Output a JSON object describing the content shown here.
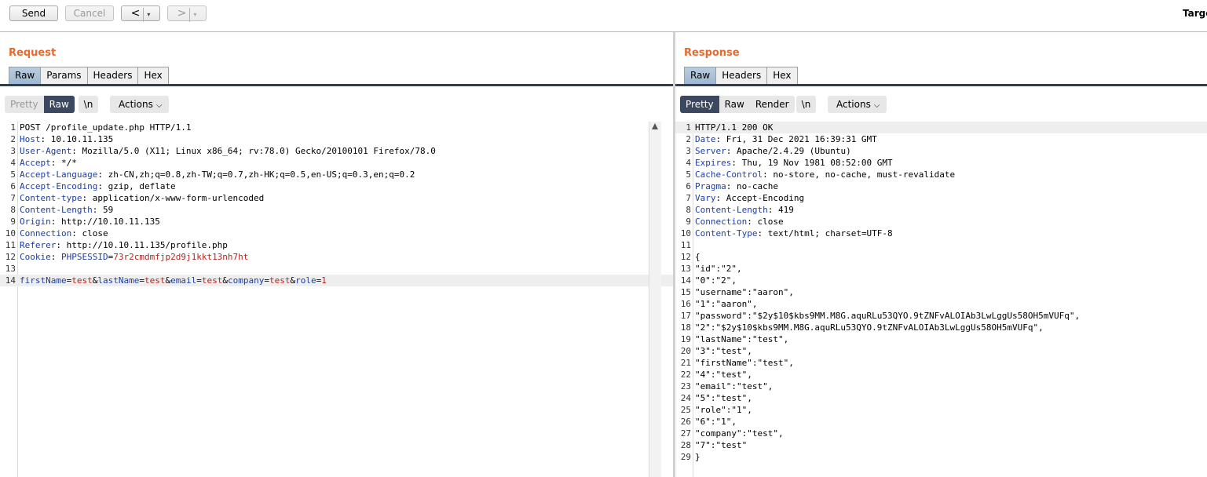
{
  "toolbar": {
    "send_label": "Send",
    "cancel_label": "Cancel",
    "back_arrow": "<",
    "forward_arrow": ">",
    "caret": "▾",
    "target_label": "Targe"
  },
  "request": {
    "title": "Request",
    "tabs": [
      "Raw",
      "Params",
      "Headers",
      "Hex"
    ],
    "active_tab": "Raw",
    "view_modes": [
      "Pretty",
      "Raw"
    ],
    "active_view": "Raw",
    "newline_label": "\\n",
    "actions_label": "Actions",
    "lines": [
      {
        "n": "1",
        "type": "plain",
        "text": "POST /profile_update.php HTTP/1.1"
      },
      {
        "n": "2",
        "type": "header",
        "key": "Host",
        "value": " 10.10.11.135"
      },
      {
        "n": "3",
        "type": "header",
        "key": "User-Agent",
        "value": " Mozilla/5.0 (X11; Linux x86_64; rv:78.0) Gecko/20100101 Firefox/78.0"
      },
      {
        "n": "4",
        "type": "header",
        "key": "Accept",
        "value": " */*"
      },
      {
        "n": "5",
        "type": "header",
        "key": "Accept-Language",
        "value": " zh-CN,zh;q=0.8,zh-TW;q=0.7,zh-HK;q=0.5,en-US;q=0.3,en;q=0.2"
      },
      {
        "n": "6",
        "type": "header",
        "key": "Accept-Encoding",
        "value": " gzip, deflate"
      },
      {
        "n": "7",
        "type": "header",
        "key": "Content-type",
        "value": " application/x-www-form-urlencoded"
      },
      {
        "n": "8",
        "type": "header",
        "key": "Content-Length",
        "value": " 59"
      },
      {
        "n": "9",
        "type": "header",
        "key": "Origin",
        "value": " http://10.10.11.135"
      },
      {
        "n": "10",
        "type": "header",
        "key": "Connection",
        "value": " close"
      },
      {
        "n": "11",
        "type": "header",
        "key": "Referer",
        "value": " http://10.10.11.135/profile.php"
      },
      {
        "n": "12",
        "type": "cookie",
        "key": "Cookie",
        "ckey": "PHPSESSID",
        "cval": "73r2cmdmfjp2d9j1kkt13nh7ht"
      },
      {
        "n": "13",
        "type": "plain",
        "text": ""
      },
      {
        "n": "14",
        "type": "params",
        "params": [
          {
            "k": "firstName",
            "v": "test"
          },
          {
            "k": "lastName",
            "v": "test"
          },
          {
            "k": "email",
            "v": "test"
          },
          {
            "k": "company",
            "v": "test"
          },
          {
            "k": "role",
            "v": "1"
          }
        ]
      }
    ]
  },
  "response": {
    "title": "Response",
    "tabs": [
      "Raw",
      "Headers",
      "Hex"
    ],
    "active_tab": "Raw",
    "view_modes": [
      "Pretty",
      "Raw",
      "Render"
    ],
    "active_view": "Pretty",
    "newline_label": "\\n",
    "actions_label": "Actions",
    "lines": [
      {
        "n": "1",
        "type": "plain",
        "text": "HTTP/1.1 200 OK"
      },
      {
        "n": "2",
        "type": "header",
        "key": "Date",
        "value": " Fri, 31 Dec 2021 16:39:31 GMT"
      },
      {
        "n": "3",
        "type": "header",
        "key": "Server",
        "value": " Apache/2.4.29 (Ubuntu)"
      },
      {
        "n": "4",
        "type": "header",
        "key": "Expires",
        "value": " Thu, 19 Nov 1981 08:52:00 GMT"
      },
      {
        "n": "5",
        "type": "header",
        "key": "Cache-Control",
        "value": " no-store, no-cache, must-revalidate"
      },
      {
        "n": "6",
        "type": "header",
        "key": "Pragma",
        "value": " no-cache"
      },
      {
        "n": "7",
        "type": "header",
        "key": "Vary",
        "value": " Accept-Encoding"
      },
      {
        "n": "8",
        "type": "header",
        "key": "Content-Length",
        "value": " 419"
      },
      {
        "n": "9",
        "type": "header",
        "key": "Connection",
        "value": " close"
      },
      {
        "n": "10",
        "type": "header",
        "key": "Content-Type",
        "value": " text/html; charset=UTF-8"
      },
      {
        "n": "11",
        "type": "plain",
        "text": ""
      },
      {
        "n": "12",
        "type": "plain",
        "text": "{"
      },
      {
        "n": "13",
        "type": "plain",
        "text": "\"id\":\"2\","
      },
      {
        "n": "14",
        "type": "plain",
        "text": "\"0\":\"2\","
      },
      {
        "n": "15",
        "type": "plain",
        "text": "\"username\":\"aaron\","
      },
      {
        "n": "16",
        "type": "plain",
        "text": "\"1\":\"aaron\","
      },
      {
        "n": "17",
        "type": "plain",
        "text": "\"password\":\"$2y$10$kbs9MM.M8G.aquRLu53QYO.9tZNFvALOIAb3LwLggUs58OH5mVUFq\","
      },
      {
        "n": "18",
        "type": "plain",
        "text": "\"2\":\"$2y$10$kbs9MM.M8G.aquRLu53QYO.9tZNFvALOIAb3LwLggUs58OH5mVUFq\","
      },
      {
        "n": "19",
        "type": "plain",
        "text": "\"lastName\":\"test\","
      },
      {
        "n": "20",
        "type": "plain",
        "text": "\"3\":\"test\","
      },
      {
        "n": "21",
        "type": "plain",
        "text": "\"firstName\":\"test\","
      },
      {
        "n": "22",
        "type": "plain",
        "text": "\"4\":\"test\","
      },
      {
        "n": "23",
        "type": "plain",
        "text": "\"email\":\"test\","
      },
      {
        "n": "24",
        "type": "plain",
        "text": "\"5\":\"test\","
      },
      {
        "n": "25",
        "type": "plain",
        "text": "\"role\":\"1\","
      },
      {
        "n": "26",
        "type": "plain",
        "text": "\"6\":\"1\","
      },
      {
        "n": "27",
        "type": "plain",
        "text": "\"company\":\"test\","
      },
      {
        "n": "28",
        "type": "plain",
        "text": "\"7\":\"test\""
      },
      {
        "n": "29",
        "type": "plain",
        "text": "}"
      }
    ]
  },
  "colors": {
    "accent_orange": "#e8692d",
    "selected_dark": "#3c4760",
    "header_key_blue": "#1d3ea0",
    "param_value_red": "#b2251e"
  },
  "icons": {
    "actions_chevron": "chevron-down-icon",
    "scroll_up": "scroll-up-arrow-icon"
  }
}
